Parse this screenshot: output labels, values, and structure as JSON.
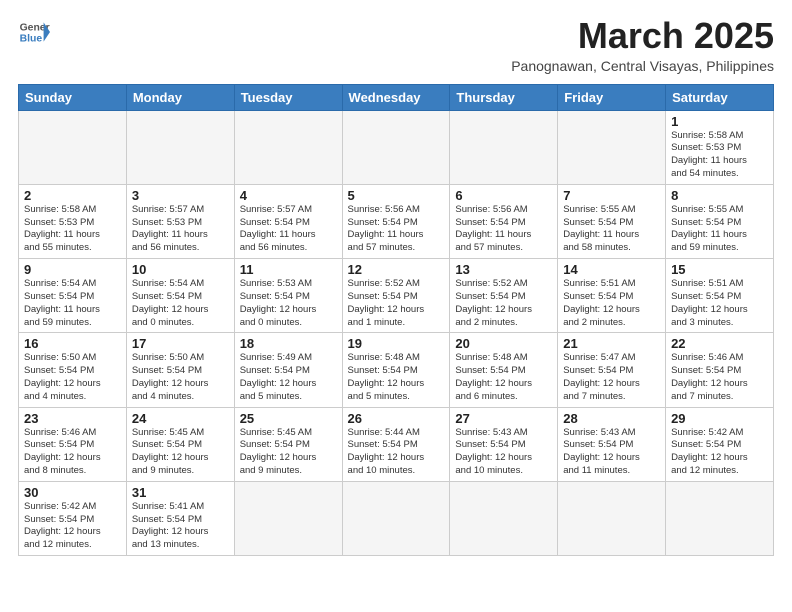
{
  "header": {
    "logo_general": "General",
    "logo_blue": "Blue",
    "title": "March 2025",
    "subtitle": "Panognawan, Central Visayas, Philippines"
  },
  "weekdays": [
    "Sunday",
    "Monday",
    "Tuesday",
    "Wednesday",
    "Thursday",
    "Friday",
    "Saturday"
  ],
  "weeks": [
    [
      {
        "day": null,
        "info": null
      },
      {
        "day": null,
        "info": null
      },
      {
        "day": null,
        "info": null
      },
      {
        "day": null,
        "info": null
      },
      {
        "day": null,
        "info": null
      },
      {
        "day": null,
        "info": null
      },
      {
        "day": "1",
        "info": "Sunrise: 5:58 AM\nSunset: 5:53 PM\nDaylight: 11 hours\nand 54 minutes."
      }
    ],
    [
      {
        "day": "2",
        "info": "Sunrise: 5:58 AM\nSunset: 5:53 PM\nDaylight: 11 hours\nand 55 minutes."
      },
      {
        "day": "3",
        "info": "Sunrise: 5:57 AM\nSunset: 5:53 PM\nDaylight: 11 hours\nand 56 minutes."
      },
      {
        "day": "4",
        "info": "Sunrise: 5:57 AM\nSunset: 5:54 PM\nDaylight: 11 hours\nand 56 minutes."
      },
      {
        "day": "5",
        "info": "Sunrise: 5:56 AM\nSunset: 5:54 PM\nDaylight: 11 hours\nand 57 minutes."
      },
      {
        "day": "6",
        "info": "Sunrise: 5:56 AM\nSunset: 5:54 PM\nDaylight: 11 hours\nand 57 minutes."
      },
      {
        "day": "7",
        "info": "Sunrise: 5:55 AM\nSunset: 5:54 PM\nDaylight: 11 hours\nand 58 minutes."
      },
      {
        "day": "8",
        "info": "Sunrise: 5:55 AM\nSunset: 5:54 PM\nDaylight: 11 hours\nand 59 minutes."
      }
    ],
    [
      {
        "day": "9",
        "info": "Sunrise: 5:54 AM\nSunset: 5:54 PM\nDaylight: 11 hours\nand 59 minutes."
      },
      {
        "day": "10",
        "info": "Sunrise: 5:54 AM\nSunset: 5:54 PM\nDaylight: 12 hours\nand 0 minutes."
      },
      {
        "day": "11",
        "info": "Sunrise: 5:53 AM\nSunset: 5:54 PM\nDaylight: 12 hours\nand 0 minutes."
      },
      {
        "day": "12",
        "info": "Sunrise: 5:52 AM\nSunset: 5:54 PM\nDaylight: 12 hours\nand 1 minute."
      },
      {
        "day": "13",
        "info": "Sunrise: 5:52 AM\nSunset: 5:54 PM\nDaylight: 12 hours\nand 2 minutes."
      },
      {
        "day": "14",
        "info": "Sunrise: 5:51 AM\nSunset: 5:54 PM\nDaylight: 12 hours\nand 2 minutes."
      },
      {
        "day": "15",
        "info": "Sunrise: 5:51 AM\nSunset: 5:54 PM\nDaylight: 12 hours\nand 3 minutes."
      }
    ],
    [
      {
        "day": "16",
        "info": "Sunrise: 5:50 AM\nSunset: 5:54 PM\nDaylight: 12 hours\nand 4 minutes."
      },
      {
        "day": "17",
        "info": "Sunrise: 5:50 AM\nSunset: 5:54 PM\nDaylight: 12 hours\nand 4 minutes."
      },
      {
        "day": "18",
        "info": "Sunrise: 5:49 AM\nSunset: 5:54 PM\nDaylight: 12 hours\nand 5 minutes."
      },
      {
        "day": "19",
        "info": "Sunrise: 5:48 AM\nSunset: 5:54 PM\nDaylight: 12 hours\nand 5 minutes."
      },
      {
        "day": "20",
        "info": "Sunrise: 5:48 AM\nSunset: 5:54 PM\nDaylight: 12 hours\nand 6 minutes."
      },
      {
        "day": "21",
        "info": "Sunrise: 5:47 AM\nSunset: 5:54 PM\nDaylight: 12 hours\nand 7 minutes."
      },
      {
        "day": "22",
        "info": "Sunrise: 5:46 AM\nSunset: 5:54 PM\nDaylight: 12 hours\nand 7 minutes."
      }
    ],
    [
      {
        "day": "23",
        "info": "Sunrise: 5:46 AM\nSunset: 5:54 PM\nDaylight: 12 hours\nand 8 minutes."
      },
      {
        "day": "24",
        "info": "Sunrise: 5:45 AM\nSunset: 5:54 PM\nDaylight: 12 hours\nand 9 minutes."
      },
      {
        "day": "25",
        "info": "Sunrise: 5:45 AM\nSunset: 5:54 PM\nDaylight: 12 hours\nand 9 minutes."
      },
      {
        "day": "26",
        "info": "Sunrise: 5:44 AM\nSunset: 5:54 PM\nDaylight: 12 hours\nand 10 minutes."
      },
      {
        "day": "27",
        "info": "Sunrise: 5:43 AM\nSunset: 5:54 PM\nDaylight: 12 hours\nand 10 minutes."
      },
      {
        "day": "28",
        "info": "Sunrise: 5:43 AM\nSunset: 5:54 PM\nDaylight: 12 hours\nand 11 minutes."
      },
      {
        "day": "29",
        "info": "Sunrise: 5:42 AM\nSunset: 5:54 PM\nDaylight: 12 hours\nand 12 minutes."
      }
    ],
    [
      {
        "day": "30",
        "info": "Sunrise: 5:42 AM\nSunset: 5:54 PM\nDaylight: 12 hours\nand 12 minutes."
      },
      {
        "day": "31",
        "info": "Sunrise: 5:41 AM\nSunset: 5:54 PM\nDaylight: 12 hours\nand 13 minutes."
      },
      {
        "day": null,
        "info": null
      },
      {
        "day": null,
        "info": null
      },
      {
        "day": null,
        "info": null
      },
      {
        "day": null,
        "info": null
      },
      {
        "day": null,
        "info": null
      }
    ]
  ]
}
